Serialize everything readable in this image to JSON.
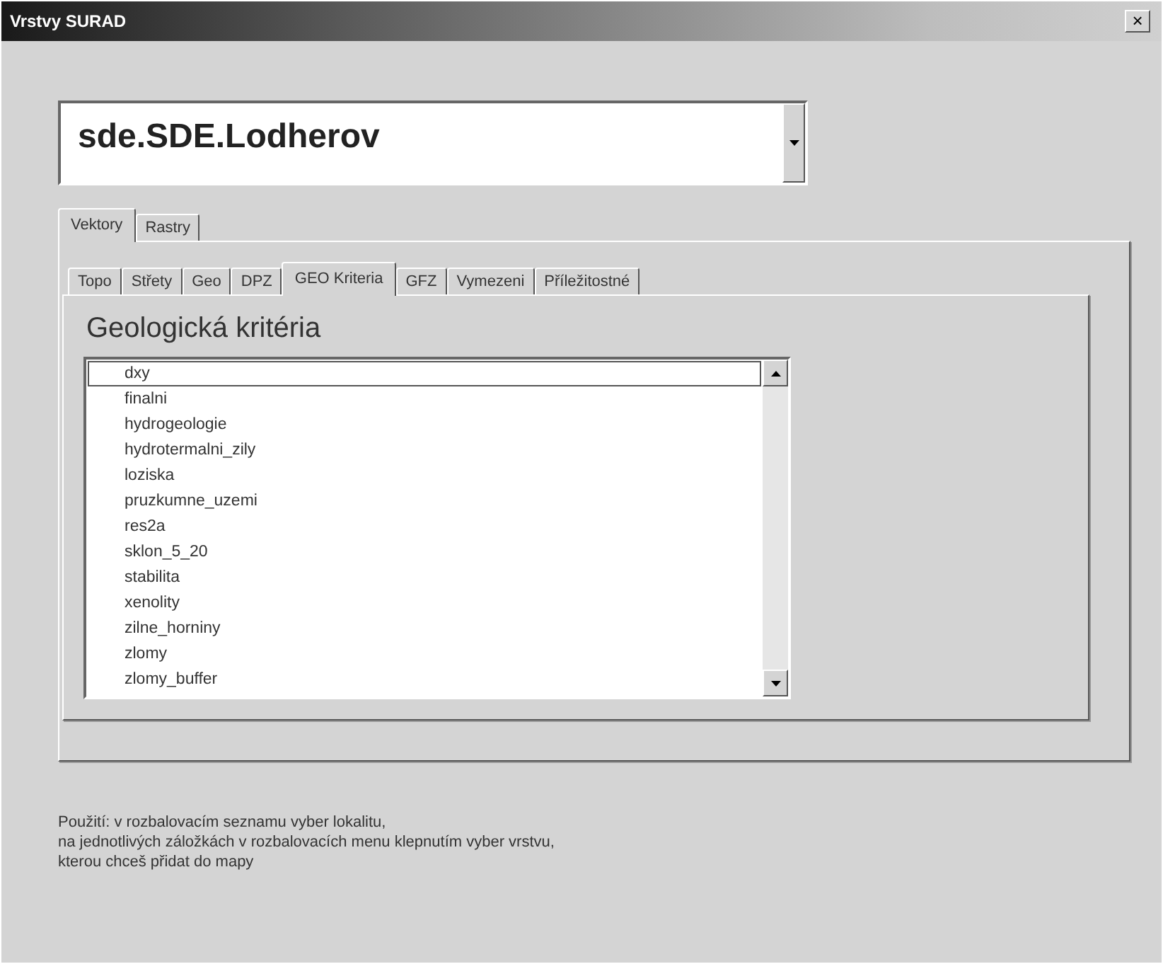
{
  "window": {
    "title": "Vrstvy SURAD",
    "close": "×"
  },
  "location_combo": {
    "value": "sde.SDE.Lodherov"
  },
  "outer_tabs": [
    {
      "label": "Vektory",
      "selected": true
    },
    {
      "label": "Rastry",
      "selected": false
    }
  ],
  "inner_tabs": [
    {
      "label": "Topo",
      "selected": false
    },
    {
      "label": "Střety",
      "selected": false
    },
    {
      "label": "Geo",
      "selected": false
    },
    {
      "label": "DPZ",
      "selected": false
    },
    {
      "label": "GEO Kriteria",
      "selected": true
    },
    {
      "label": "GFZ",
      "selected": false
    },
    {
      "label": "Vymezeni",
      "selected": false
    },
    {
      "label": "Příležitostné",
      "selected": false
    }
  ],
  "panel_heading": "Geologická kritéria",
  "layer_list": [
    {
      "label": "dxy",
      "selected": true
    },
    {
      "label": "finalni",
      "selected": false
    },
    {
      "label": "hydrogeologie",
      "selected": false
    },
    {
      "label": "hydrotermalni_zily",
      "selected": false
    },
    {
      "label": "loziska",
      "selected": false
    },
    {
      "label": "pruzkumne_uzemi",
      "selected": false
    },
    {
      "label": "res2a",
      "selected": false
    },
    {
      "label": "sklon_5_20",
      "selected": false
    },
    {
      "label": "stabilita",
      "selected": false
    },
    {
      "label": "xenolity",
      "selected": false
    },
    {
      "label": "zilne_horniny",
      "selected": false
    },
    {
      "label": "zlomy",
      "selected": false
    },
    {
      "label": "zlomy_buffer",
      "selected": false
    }
  ],
  "usage_note": [
    "Použití: v rozbalovacím seznamu vyber lokalitu,",
    "na jednotlivých záložkách v rozbalovacích menu klepnutím vyber vrstvu,",
    "kterou chceš přidat do mapy"
  ]
}
